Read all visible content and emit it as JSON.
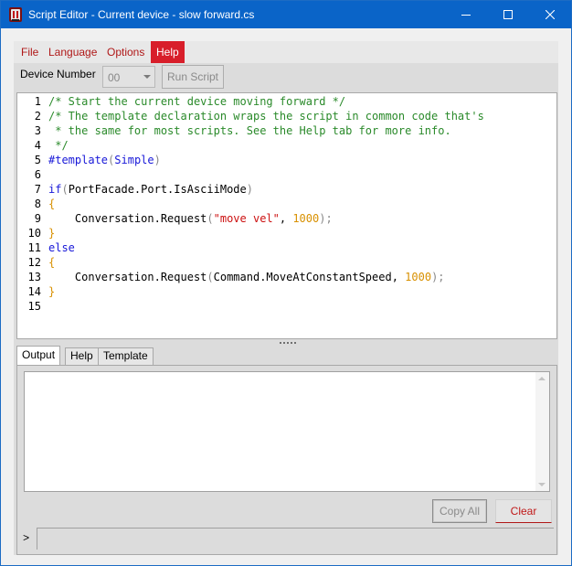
{
  "window": {
    "title": "Script Editor - Current device - slow forward.cs",
    "colors": {
      "titlebar": "#0a64c8",
      "accent": "#d81e2a",
      "menu_text": "#b01818"
    }
  },
  "menu": {
    "items": [
      {
        "label": "File"
      },
      {
        "label": "Language"
      },
      {
        "label": "Options"
      },
      {
        "label": "Help",
        "active": true
      }
    ]
  },
  "toolbar": {
    "device_label": "Device Number",
    "device_value": "00",
    "run_label": "Run Script"
  },
  "editor": {
    "lines": [
      [
        {
          "t": "/* Start the current device moving forward */",
          "c": "comment"
        }
      ],
      [
        {
          "t": "/* The template declaration wraps the script in common code that's",
          "c": "comment"
        }
      ],
      [
        {
          "t": " * the same for most scripts. See the Help tab for more info.",
          "c": "comment"
        }
      ],
      [
        {
          "t": " */",
          "c": "comment"
        }
      ],
      [
        {
          "t": "#template",
          "c": "directive"
        },
        {
          "t": "(",
          "c": "punct"
        },
        {
          "t": "Simple",
          "c": "directive"
        },
        {
          "t": ")",
          "c": "punct"
        }
      ],
      [],
      [
        {
          "t": "if",
          "c": "keyword"
        },
        {
          "t": "(",
          "c": "punct"
        },
        {
          "t": "PortFacade.Port.IsAsciiMode",
          "c": "plain"
        },
        {
          "t": ")",
          "c": "punct"
        }
      ],
      [
        {
          "t": "{",
          "c": "brace"
        }
      ],
      [
        {
          "t": "    Conversation.Request",
          "c": "plain"
        },
        {
          "t": "(",
          "c": "punct"
        },
        {
          "t": "\"move vel\"",
          "c": "string"
        },
        {
          "t": ", ",
          "c": "plain"
        },
        {
          "t": "1000",
          "c": "number"
        },
        {
          "t": ");",
          "c": "punct"
        }
      ],
      [
        {
          "t": "}",
          "c": "brace"
        }
      ],
      [
        {
          "t": "else",
          "c": "keyword"
        }
      ],
      [
        {
          "t": "{",
          "c": "brace"
        }
      ],
      [
        {
          "t": "    Conversation.Request",
          "c": "plain"
        },
        {
          "t": "(",
          "c": "punct"
        },
        {
          "t": "Command.MoveAtConstantSpeed",
          "c": "plain"
        },
        {
          "t": ", ",
          "c": "plain"
        },
        {
          "t": "1000",
          "c": "number"
        },
        {
          "t": ");",
          "c": "punct"
        }
      ],
      [
        {
          "t": "}",
          "c": "brace"
        }
      ],
      []
    ],
    "line_numbers": [
      "1",
      "2",
      "3",
      "4",
      "5",
      "6",
      "7",
      "8",
      "9",
      "10",
      "11",
      "12",
      "13",
      "14",
      "15"
    ]
  },
  "bottom_tabs": [
    {
      "label": "Output",
      "selected": true
    },
    {
      "label": "Help"
    },
    {
      "label": "Template"
    }
  ],
  "output": {
    "text": "",
    "copy_all_label": "Copy All",
    "clear_label": "Clear",
    "prompt": ">",
    "command_value": ""
  },
  "icons": {
    "app": "script-app-icon",
    "minimize": "minimize-icon",
    "maximize": "maximize-icon",
    "close": "close-icon"
  }
}
